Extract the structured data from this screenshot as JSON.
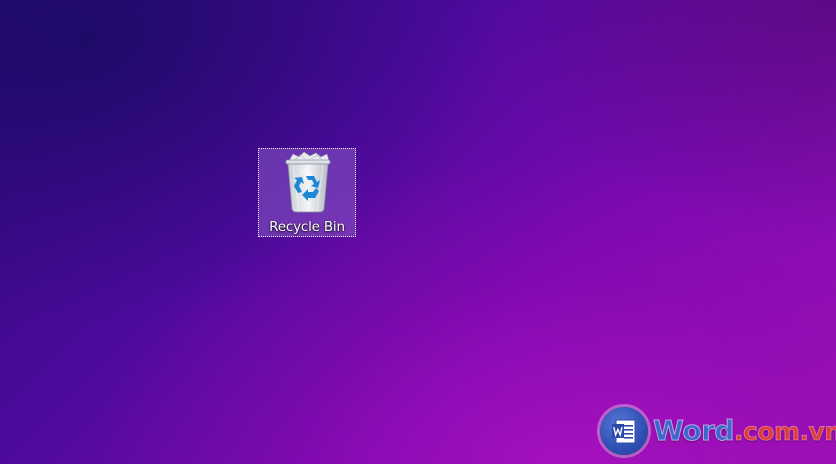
{
  "desktop": {
    "icons": [
      {
        "label": "Recycle Bin",
        "icon": "recycle-bin-icon",
        "selected": true
      }
    ]
  },
  "watermark": {
    "logo_icon": "word-logo-icon",
    "word": "Word",
    "domain": ".com.vn",
    "word_color": "#3f66cf",
    "domain_color": "#e23a3a"
  },
  "colors": {
    "background_start": "#2a0a78",
    "background_end": "#9a10b4",
    "selection_fill": "#8c5ac8"
  }
}
